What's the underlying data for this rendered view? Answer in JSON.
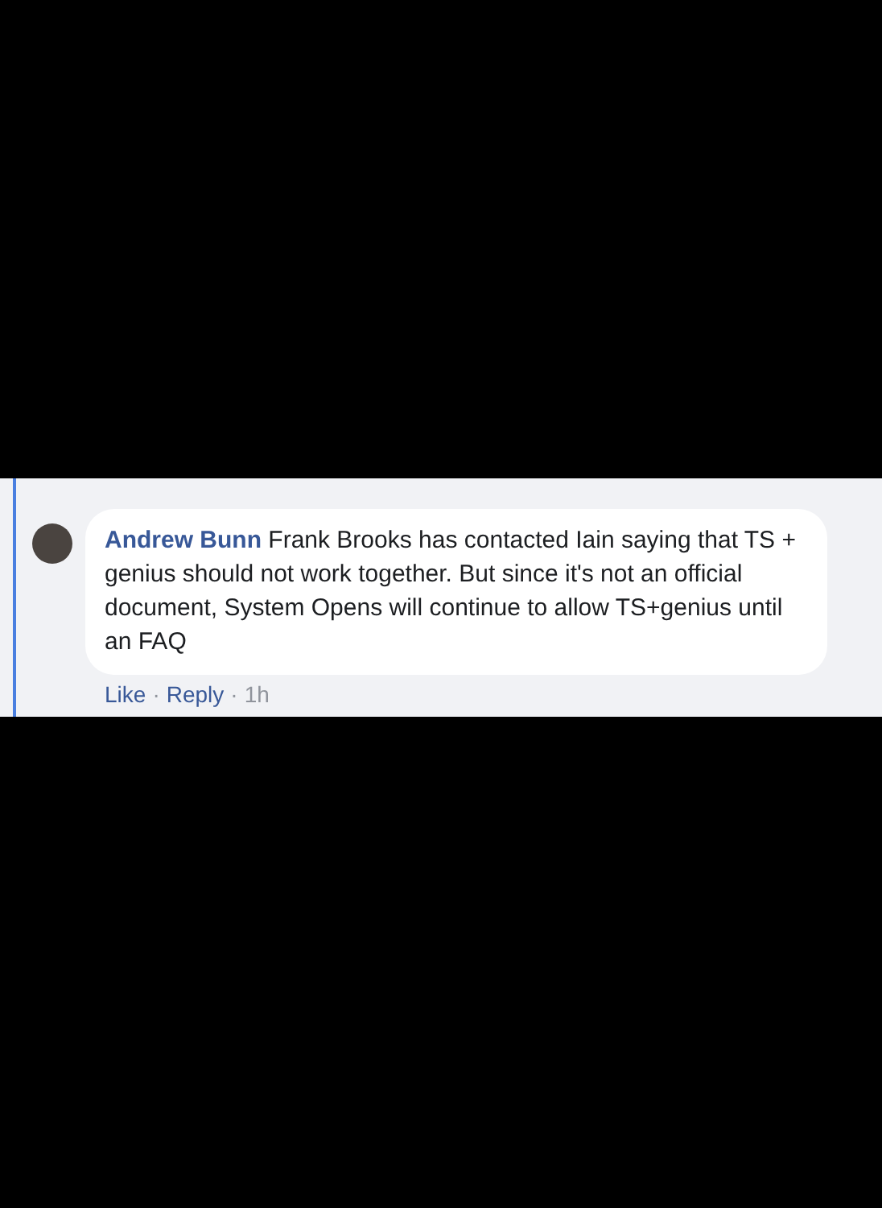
{
  "comment": {
    "author": "Andrew Bunn",
    "text": "Frank Brooks has contacted Iain saying that TS + genius should not work together. But since it's not an official document, System Opens will continue to allow TS+genius until an FAQ",
    "actions": [
      {
        "label": "Like",
        "kind": "link"
      },
      {
        "label": "·",
        "kind": "separator"
      },
      {
        "label": "Reply",
        "kind": "link"
      },
      {
        "label": "·",
        "kind": "separator"
      },
      {
        "label": "1h",
        "kind": "time"
      }
    ]
  }
}
